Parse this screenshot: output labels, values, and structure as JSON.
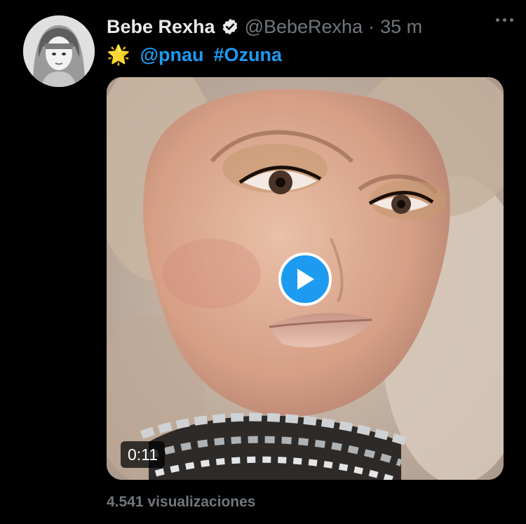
{
  "author": {
    "name": "Bebe Rexha",
    "handle": "@BebeRexha",
    "separator": "·",
    "time": "35 m",
    "verified_icon": "verified-badge-icon"
  },
  "tweet": {
    "emoji": "🌟",
    "mention": "@pnau",
    "hashtag": "#Ozuna"
  },
  "video": {
    "duration": "0:11",
    "play_icon": "play-icon"
  },
  "stats": {
    "views": "4.541 visualizaciones"
  },
  "colors": {
    "background": "#000000",
    "accent": "#1d9bf0",
    "secondary_text": "#71767b",
    "primary_text": "#e7e9ea"
  }
}
